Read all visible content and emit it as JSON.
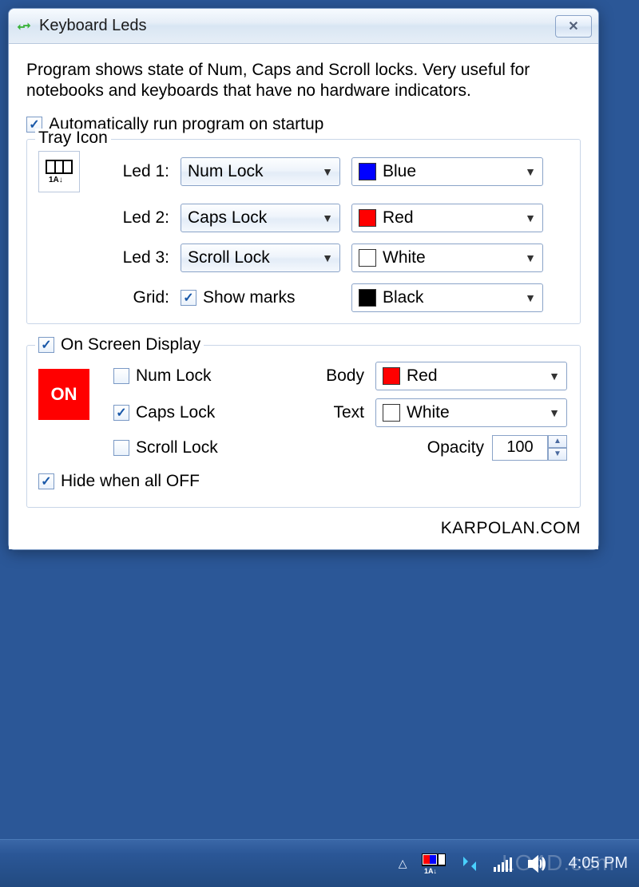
{
  "window": {
    "title": "Keyboard Leds"
  },
  "description": "Program shows state of Num, Caps and Scroll locks. Very useful for notebooks and keyboards that have no hardware indicators.",
  "autostart_label": "Automatically run program on startup",
  "tray": {
    "legend": "Tray Icon",
    "rows": [
      {
        "label": "Led 1:",
        "lock": "Num Lock",
        "color_name": "Blue",
        "swatch_class": "sw-blue"
      },
      {
        "label": "Led 2:",
        "lock": "Caps Lock",
        "color_name": "Red",
        "swatch_class": "sw-red"
      },
      {
        "label": "Led 3:",
        "lock": "Scroll Lock",
        "color_name": "White",
        "swatch_class": "sw-white"
      }
    ],
    "grid_label": "Grid:",
    "grid_check_label": "Show marks",
    "grid_color_name": "Black"
  },
  "osd": {
    "legend": "On Screen Display",
    "badge_text": "ON",
    "locks": [
      {
        "label": "Num Lock",
        "checked": false
      },
      {
        "label": "Caps Lock",
        "checked": true
      },
      {
        "label": "Scroll Lock",
        "checked": false
      }
    ],
    "body_label": "Body",
    "body_color_name": "Red",
    "text_label": "Text",
    "text_color_name": "White",
    "opacity_label": "Opacity",
    "opacity_value": "100",
    "hide_label": "Hide when all OFF"
  },
  "footer_link": "KARPOLAN.COM",
  "taskbar": {
    "clock": "4:05 PM"
  },
  "watermark": "LO4D.com"
}
